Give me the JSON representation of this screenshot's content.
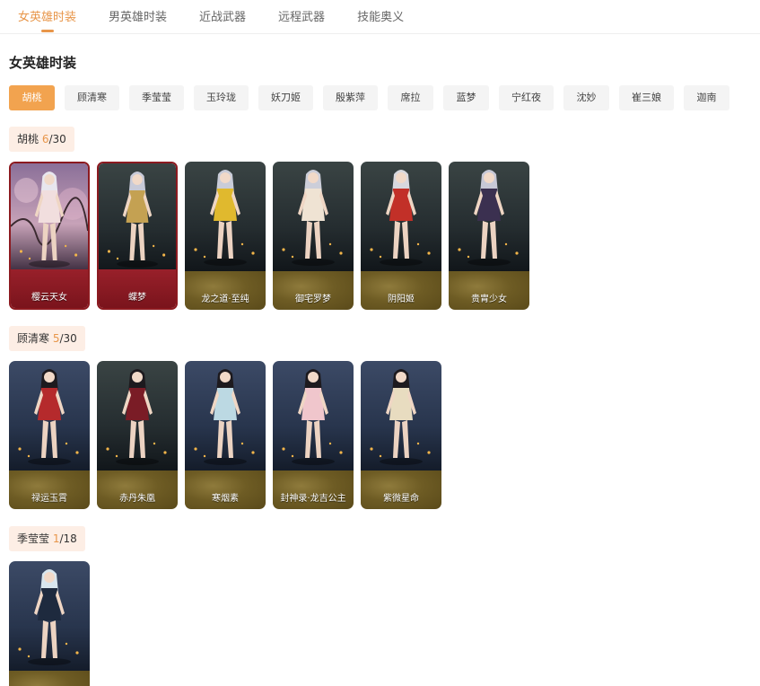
{
  "tabs": [
    "女英雄时装",
    "男英雄时装",
    "近战武器",
    "远程武器",
    "技能奥义"
  ],
  "page_title": "女英雄时装",
  "filters": [
    "胡桃",
    "顾清寒",
    "季莹莹",
    "玉玲珑",
    "妖刀姬",
    "殷紫萍",
    "席拉",
    "蓝梦",
    "宁红夜",
    "沈妙",
    "崔三娘",
    "迦南"
  ],
  "sections": [
    {
      "hero": "胡桃",
      "owned": "6",
      "total": "/30",
      "skins": [
        {
          "name": "樱云天女",
          "frame": "red",
          "scene": "pink",
          "outfit": "#f1dede",
          "hair": "#e8e6ee"
        },
        {
          "name": "蝶梦",
          "frame": "red",
          "scene": "dark",
          "outfit": "#c4a152",
          "hair": "#c8cad8"
        },
        {
          "name": "龙之道·至纯",
          "frame": "gold",
          "scene": "dark",
          "outfit": "#e0b92e",
          "hair": "#c9ccd8"
        },
        {
          "name": "御宅罗梦",
          "frame": "gold",
          "scene": "dark",
          "outfit": "#efe3d3",
          "hair": "#ccced9"
        },
        {
          "name": "阴阳姬",
          "frame": "gold",
          "scene": "dark",
          "outfit": "#c23028",
          "hair": "#d8d8de"
        },
        {
          "name": "贵胄少女",
          "frame": "gold",
          "scene": "dark",
          "outfit": "#3b3050",
          "hair": "#c7c8d6"
        }
      ]
    },
    {
      "hero": "顾清寒",
      "owned": "5",
      "total": "/30",
      "skins": [
        {
          "name": "禄运玉霄",
          "frame": "gold",
          "scene": "blue",
          "outfit": "#b52a2c",
          "hair": "#1d1a1e"
        },
        {
          "name": "赤丹朱凰",
          "frame": "gold",
          "scene": "dark",
          "outfit": "#7a1c26",
          "hair": "#1d1a1e"
        },
        {
          "name": "寒烟素",
          "frame": "gold",
          "scene": "blue",
          "outfit": "#bcd9e3",
          "hair": "#1d1a1e"
        },
        {
          "name": "封神录·龙吉公主",
          "frame": "gold",
          "scene": "blue",
          "outfit": "#f0c6cc",
          "hair": "#1d1a1e"
        },
        {
          "name": "紫微星命",
          "frame": "gold",
          "scene": "blue",
          "outfit": "#e8dcc0",
          "hair": "#1d1a1e"
        }
      ]
    },
    {
      "hero": "季莹莹",
      "owned": "1",
      "total": "/18",
      "skins": [
        {
          "name": "",
          "frame": "gold",
          "scene": "blue",
          "outfit": "#1e2a3e",
          "hair": "#d8e6ee"
        }
      ]
    }
  ],
  "colors": {
    "accent": "#e8964a",
    "filter_active": "#f2a34f",
    "badge_bg": "#fdeee5",
    "frame_red": "#8c1a20",
    "base_gold": "#6e5c24"
  }
}
